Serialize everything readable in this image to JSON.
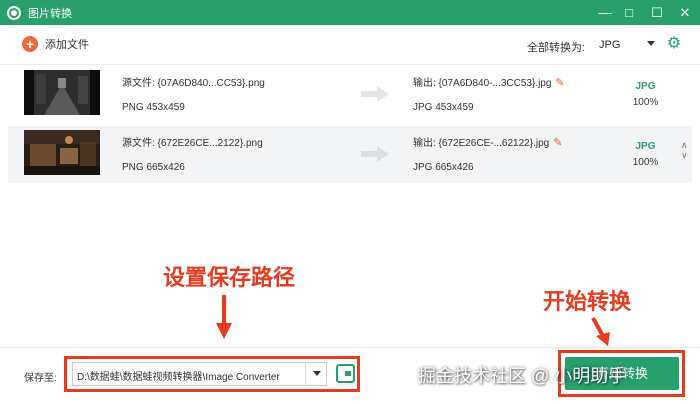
{
  "window": {
    "title": "图片转换"
  },
  "toolbar": {
    "add_file_label": "添加文件",
    "convert_all_label": "全部转换为:",
    "format_value": "JPG"
  },
  "files": [
    {
      "source_label": "源文件: {07A6D840...CC53}.png",
      "source_info": "PNG   453x459",
      "output_label": "输出: {07A6D840-...3CC53}.jpg",
      "output_info": "JPG   453x459",
      "format": "JPG",
      "quality": "100%"
    },
    {
      "source_label": "源文件: {672E26CE...2122}.png",
      "source_info": "PNG   665x426",
      "output_label": "输出: {672E26CE-...62122}.jpg",
      "output_info": "JPG   665x426",
      "format": "JPG",
      "quality": "100%"
    }
  ],
  "bottom": {
    "save_to_label": "保存至:",
    "save_path": "D:\\数据蛙\\数据蛙视频转换器\\Image Converter",
    "start_label": "开始转换"
  },
  "annotations": {
    "set_path": "设置保存路径",
    "start": "开始转换"
  },
  "watermark": "掘金技术社区 @ 小明助手",
  "colors": {
    "accent": "#27a06c",
    "annotation_red": "#e63b1f",
    "add_orange": "#ef6a3c"
  },
  "icons": [
    "app-icon",
    "minimize-icon",
    "maximize-icon",
    "close-icon",
    "plus-icon",
    "chevron-down-icon",
    "gear-icon",
    "arrow-right-icon",
    "pencil-icon",
    "chevron-up-icon",
    "folder-icon"
  ]
}
